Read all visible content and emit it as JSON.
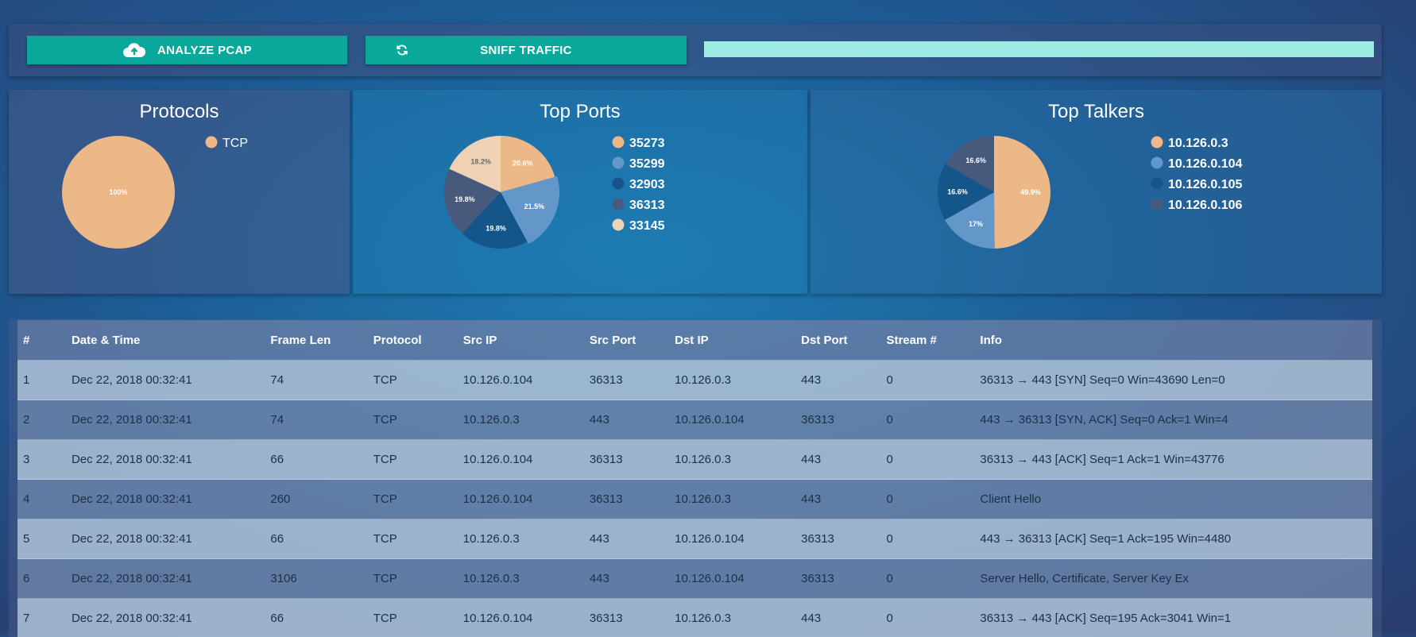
{
  "toolbar": {
    "analyze_label": "ANALYZE PCAP",
    "analyze_icon": "cloud-upload-icon",
    "sniff_label": "SNIFF TRAFFIC",
    "sniff_icon": "refresh-icon",
    "progress_percent": 100,
    "accent": "#0aa89a",
    "progress_color": "#9eebe3"
  },
  "chart_data": [
    {
      "type": "pie",
      "title": "Protocols",
      "labels": [
        "TCP"
      ],
      "values": [
        100
      ],
      "value_labels": [
        "100%"
      ],
      "colors": [
        "#ecb888"
      ],
      "legend": "right"
    },
    {
      "type": "pie",
      "title": "Top Ports",
      "labels": [
        "35273",
        "35299",
        "32903",
        "36313",
        "33145"
      ],
      "values": [
        20.6,
        21.5,
        19.8,
        19.8,
        18.2
      ],
      "value_labels": [
        "20.6%",
        "21.5%",
        "19.8%",
        "19.8%",
        "18.2%"
      ],
      "colors": [
        "#ecb888",
        "#6497c9",
        "#14558a",
        "#475a7c",
        "#efd1b6"
      ],
      "highlighted": "35299",
      "legend": "right"
    },
    {
      "type": "pie",
      "title": "Top Talkers",
      "labels": [
        "10.126.0.3",
        "10.126.0.104",
        "10.126.0.105",
        "10.126.0.106"
      ],
      "values": [
        49.9,
        17,
        16.6,
        16.6
      ],
      "value_labels": [
        "49.9%",
        "17%",
        "16.6%",
        "16.6%"
      ],
      "colors": [
        "#ecb888",
        "#6497c9",
        "#14558a",
        "#475a7c"
      ],
      "legend": "right"
    }
  ],
  "table": {
    "columns": [
      "#",
      "Date & Time",
      "Frame Len",
      "Protocol",
      "Src IP",
      "Src Port",
      "Dst IP",
      "Dst Port",
      "Stream #",
      "Info"
    ],
    "rows": [
      [
        "1",
        "Dec 22, 2018 00:32:41",
        "74",
        "TCP",
        "10.126.0.104",
        "36313",
        "10.126.0.3",
        "443",
        "0",
        "36313 → 443 [SYN] Seq=0 Win=43690 Len=0"
      ],
      [
        "2",
        "Dec 22, 2018 00:32:41",
        "74",
        "TCP",
        "10.126.0.3",
        "443",
        "10.126.0.104",
        "36313",
        "0",
        "443 → 36313 [SYN, ACK] Seq=0 Ack=1 Win=4"
      ],
      [
        "3",
        "Dec 22, 2018 00:32:41",
        "66",
        "TCP",
        "10.126.0.104",
        "36313",
        "10.126.0.3",
        "443",
        "0",
        "36313 → 443 [ACK] Seq=1 Ack=1 Win=43776"
      ],
      [
        "4",
        "Dec 22, 2018 00:32:41",
        "260",
        "TCP",
        "10.126.0.104",
        "36313",
        "10.126.0.3",
        "443",
        "0",
        "Client Hello"
      ],
      [
        "5",
        "Dec 22, 2018 00:32:41",
        "66",
        "TCP",
        "10.126.0.3",
        "443",
        "10.126.0.104",
        "36313",
        "0",
        "443 → 36313 [ACK] Seq=1 Ack=195 Win=4480"
      ],
      [
        "6",
        "Dec 22, 2018 00:32:41",
        "3106",
        "TCP",
        "10.126.0.3",
        "443",
        "10.126.0.104",
        "36313",
        "0",
        "Server Hello, Certificate, Server Key Ex"
      ],
      [
        "7",
        "Dec 22, 2018 00:32:41",
        "66",
        "TCP",
        "10.126.0.104",
        "36313",
        "10.126.0.3",
        "443",
        "0",
        "36313 → 443 [ACK] Seq=195 Ack=3041 Win=1"
      ]
    ]
  }
}
